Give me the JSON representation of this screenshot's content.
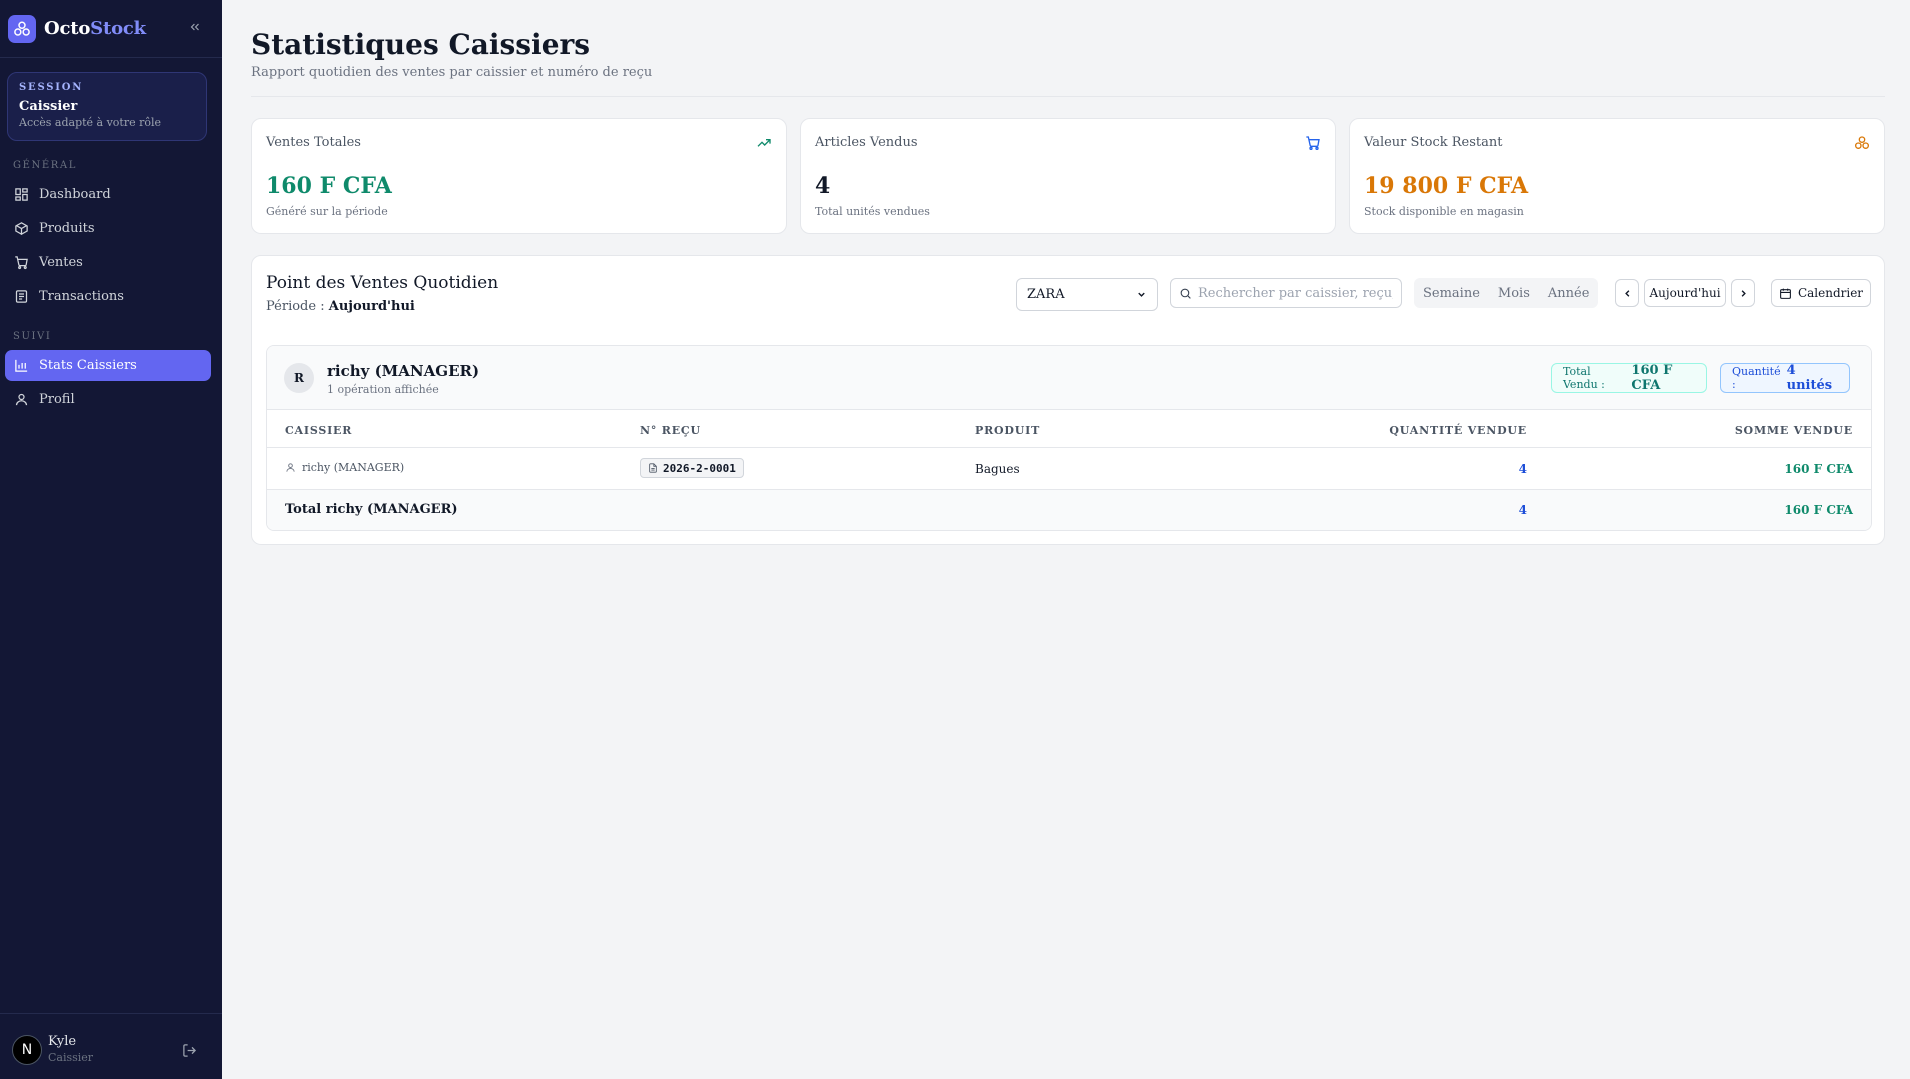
{
  "brand": {
    "name_a": "Octo",
    "name_b": "Stock"
  },
  "session": {
    "label": "SESSION",
    "role": "Caissier",
    "desc": "Accès adapté à votre rôle"
  },
  "sidebar": {
    "section_general": "GÉNÉRAL",
    "section_suivi": "SUIVI",
    "items": [
      {
        "label": "Dashboard",
        "icon": "dashboard-icon"
      },
      {
        "label": "Produits",
        "icon": "box-icon"
      },
      {
        "label": "Ventes",
        "icon": "cart-icon"
      },
      {
        "label": "Transactions",
        "icon": "receipt-icon"
      },
      {
        "label": "Stats Caissiers",
        "icon": "bar-chart-icon",
        "active": true
      },
      {
        "label": "Profil",
        "icon": "user-icon"
      }
    ]
  },
  "user": {
    "initial": "N",
    "name": "Kyle",
    "role": "Caissier"
  },
  "page": {
    "title": "Statistiques Caissiers",
    "subtitle": "Rapport quotidien des ventes par caissier et numéro de reçu"
  },
  "cards": [
    {
      "label": "Ventes Totales",
      "value": "160 F CFA",
      "desc": "Généré sur la période",
      "color": "#0f8a6b",
      "icon": "trending-up-icon"
    },
    {
      "label": "Articles Vendus",
      "value": "4",
      "desc": "Total unités vendues",
      "color": "#111827",
      "icon": "cart-icon"
    },
    {
      "label": "Valeur Stock Restant",
      "value": "19 800 F CFA",
      "desc": "Stock disponible en magasin",
      "color": "#d97706",
      "icon": "stock-icon"
    }
  ],
  "panel": {
    "title": "Point des Ventes Quotidien",
    "period_label": "Période :",
    "period_value": "Aujourd'hui",
    "store_select": "ZARA",
    "search_placeholder": "Rechercher par caissier, reçu, produit...",
    "segments": [
      "Semaine",
      "Mois",
      "Année"
    ],
    "today_label": "Aujourd'hui",
    "calendar_label": "Calendrier"
  },
  "group": {
    "initial": "R",
    "name": "richy (MANAGER)",
    "sub": "1 opération affichée",
    "total_label": "Total Vendu :",
    "total_value": "160 F CFA",
    "qty_label": "Quantité :",
    "qty_value": "4 unités",
    "columns": [
      "CAISSIER",
      "N° REÇU",
      "PRODUIT",
      "QUANTITÉ VENDUE",
      "SOMME VENDUE"
    ],
    "rows": [
      {
        "cashier": "richy (MANAGER)",
        "receipt": "2026-2-0001",
        "product": "Bagues",
        "qty": "4",
        "amount": "160 F CFA"
      }
    ],
    "total_row": {
      "label": "Total richy (MANAGER)",
      "qty": "4",
      "amount": "160 F CFA"
    }
  },
  "colors": {
    "accent": "#6366f1",
    "sidebar_bg": "#131735",
    "green": "#0f8a6b",
    "blue": "#1d4ed8",
    "orange": "#d97706"
  }
}
